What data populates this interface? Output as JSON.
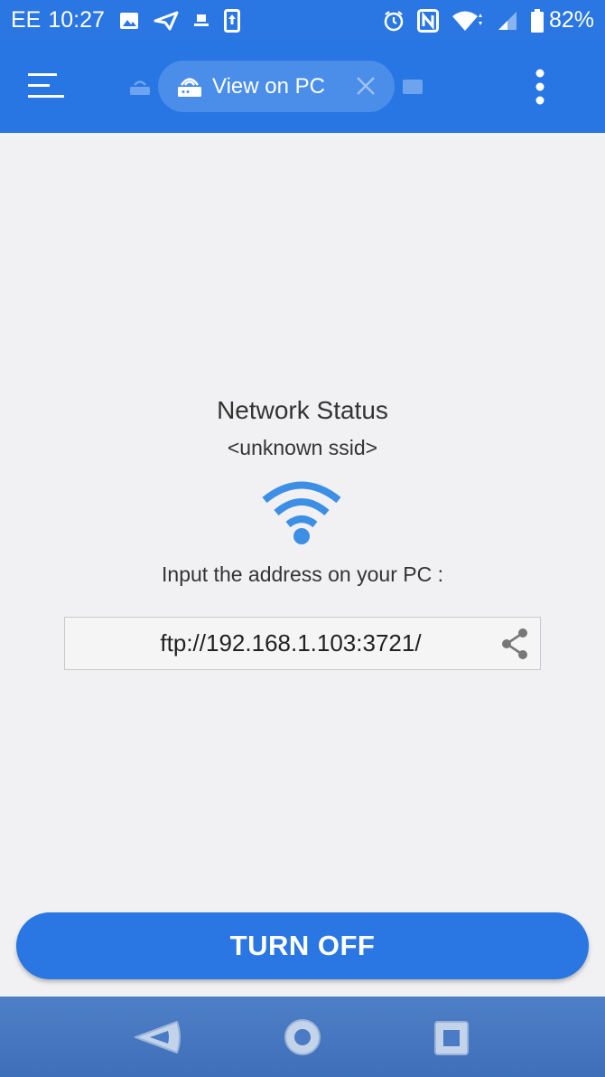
{
  "status_bar": {
    "carrier": "EE",
    "time": "10:27",
    "battery": "82%",
    "icons_left": [
      "image-icon",
      "send-icon",
      "network-icon",
      "upload-icon"
    ],
    "icons_right": [
      "alarm-icon",
      "nfc-icon",
      "wifi-icon",
      "signal-icon",
      "battery-icon"
    ]
  },
  "app_bar": {
    "tab_label": "View on PC",
    "colors": {
      "primary": "#2876e3",
      "chip": "#4a8eea"
    }
  },
  "main": {
    "title": "Network Status",
    "ssid": "<unknown ssid>",
    "instruction": "Input the address on your PC :",
    "address": "ftp://192.168.1.103:3721/",
    "wifi_color": "#3d8fe6"
  },
  "actions": {
    "turn_off_label": "TURN OFF"
  },
  "nav_bar": {
    "buttons": [
      "back",
      "home",
      "recents"
    ]
  }
}
